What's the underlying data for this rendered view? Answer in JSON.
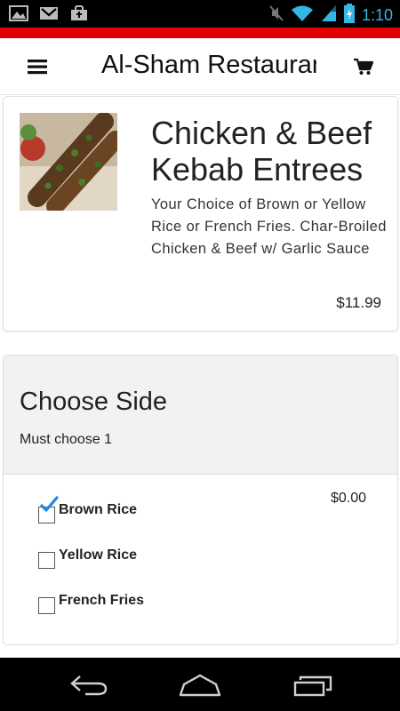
{
  "status_bar": {
    "time": "1:10",
    "icons": [
      "image-notification-icon",
      "gmail-notification-icon",
      "shopping-bag-notification-icon",
      "mute-icon",
      "wifi-icon",
      "signal-icon",
      "battery-charging-icon"
    ]
  },
  "colors": {
    "accent_bar": "#e00000",
    "status_time": "#33b5e5",
    "checkmark": "#1e88e5"
  },
  "app_bar": {
    "title": "Al-Sham Restaurant",
    "menu_icon": "hamburger-menu-icon",
    "cart_icon": "shopping-cart-icon"
  },
  "item": {
    "name": "Chicken & Beef Kebab Entrees",
    "description": "Your Choice of Brown or Yellow Rice or French Fries. Char-Broiled Chicken & Beef w/ Garlic Sauce",
    "price": "$11.99"
  },
  "options": {
    "title": "Choose Side",
    "subtitle": "Must choose 1",
    "items": [
      {
        "label": "Brown Rice",
        "price": "$0.00",
        "checked": true
      },
      {
        "label": "Yellow Rice",
        "price": "",
        "checked": false
      },
      {
        "label": "French Fries",
        "price": "",
        "checked": false
      }
    ]
  },
  "nav_bar": {
    "icons": [
      "back-icon",
      "home-icon",
      "recent-apps-icon"
    ]
  }
}
